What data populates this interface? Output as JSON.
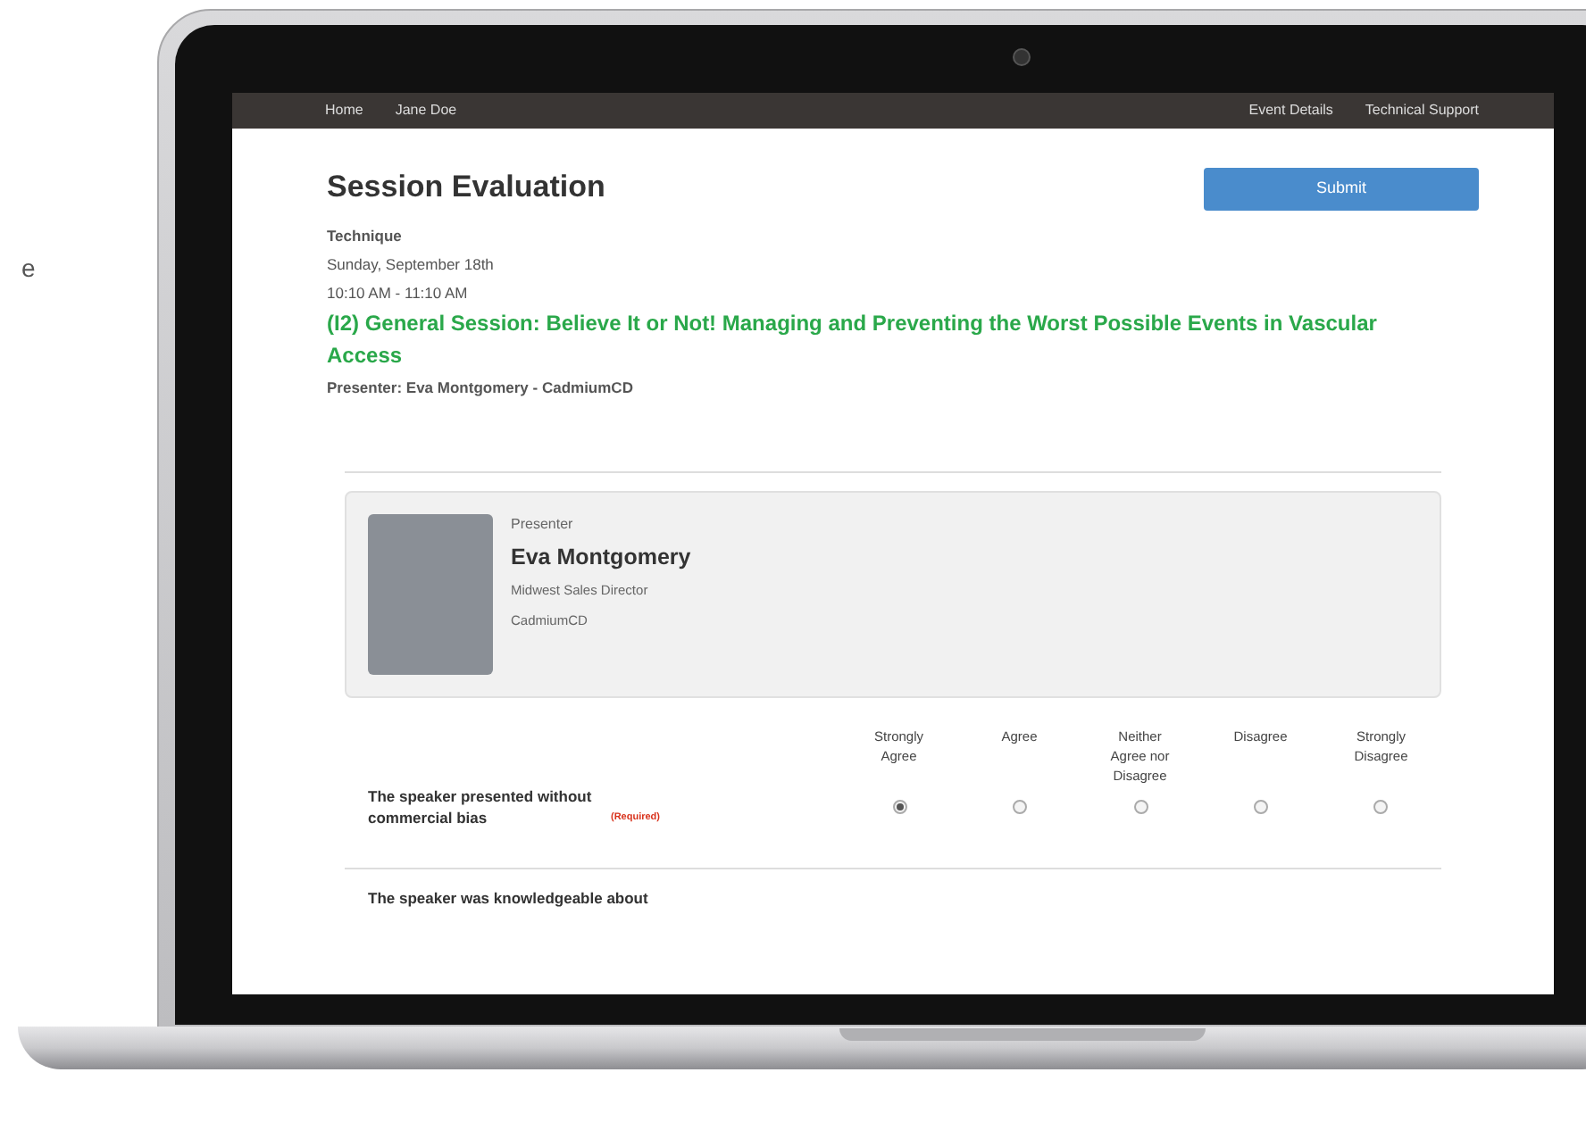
{
  "caption_fragment": "e",
  "nav": {
    "left": [
      "Home",
      "Jane Doe"
    ],
    "right": [
      "Event Details",
      "Technical Support"
    ]
  },
  "page": {
    "title": "Session Evaluation",
    "submit": "Submit",
    "category": "Technique",
    "date": "Sunday, September 18th",
    "time": "10:10 AM - 11:10 AM",
    "session_title": "(I2) General Session: Believe It or Not! Managing and Preventing the Worst Possible Events in Vascular Access",
    "presenter_line": "Presenter: Eva Montgomery - CadmiumCD"
  },
  "presenter_card": {
    "label": "Presenter",
    "name": "Eva Montgomery",
    "role": "Midwest Sales Director",
    "company": "CadmiumCD"
  },
  "scale": {
    "columns": [
      "Strongly Agree",
      "Agree",
      "Neither Agree nor Disagree",
      "Disagree",
      "Strongly Disagree"
    ]
  },
  "questions": [
    {
      "text": "The speaker presented without commercial bias",
      "required_label": "(Required)",
      "answers": [
        {
          "selected": true
        },
        {
          "selected": false
        },
        {
          "selected": false
        },
        {
          "selected": false
        },
        {
          "selected": false
        }
      ]
    },
    {
      "text": "The speaker was knowledgeable about"
    }
  ]
}
